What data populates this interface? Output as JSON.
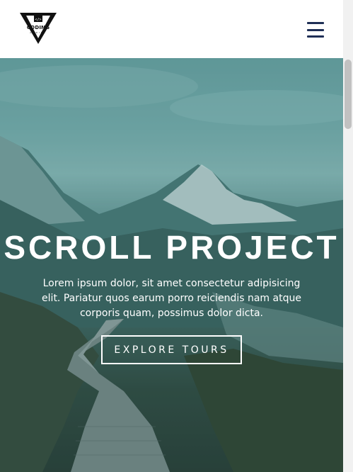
{
  "nav": {
    "logo": {
      "name": "CODING",
      "tagline": "ADDICT",
      "icon": "coding-addict-logo"
    },
    "toggle": {
      "icon": "hamburger-menu-icon",
      "color": "#1f2f56"
    }
  },
  "hero": {
    "title": "SCROLL PROJECT",
    "text": "Lorem ipsum dolor, sit amet consectetur adipisicing elit. Pariatur quos earum porro reiciendis nam atque corporis quam, possimus dolor dicta.",
    "button_label": "EXPLORE TOURS",
    "overlay_color": "#145a5a"
  }
}
